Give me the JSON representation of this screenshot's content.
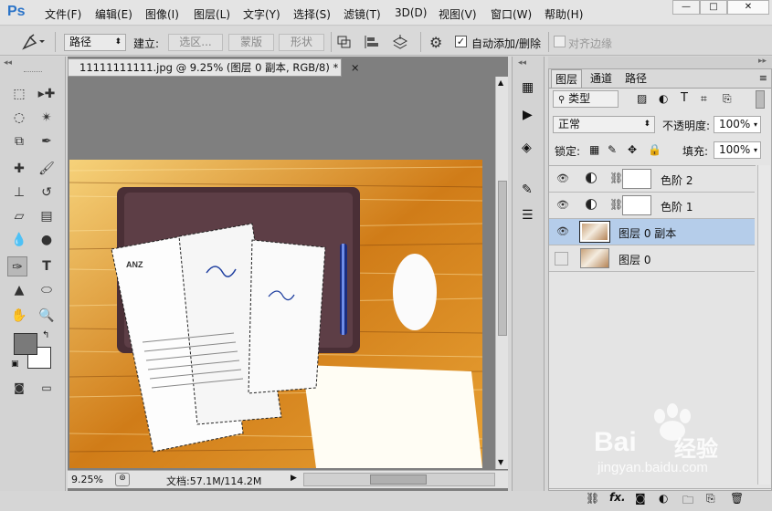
{
  "app": {
    "logo": "Ps"
  },
  "menu": [
    "文件(F)",
    "编辑(E)",
    "图像(I)",
    "图层(L)",
    "文字(Y)",
    "选择(S)",
    "滤镜(T)",
    "3D(D)",
    "视图(V)",
    "窗口(W)",
    "帮助(H)"
  ],
  "window_controls": {
    "minimize": "—",
    "maximize": "□",
    "close": "✕"
  },
  "options": {
    "mode_value": "路径",
    "build_label": "建立:",
    "selection_btn": "选区...",
    "mask_btn": "蒙版",
    "shape_btn": "形状",
    "auto_add_label": "自动添加/删除",
    "auto_add_checked": true,
    "align_edges_label": "对齐边缘",
    "align_edges_checked": false
  },
  "document": {
    "tab_title": "11111111111.jpg @ 9.25% (图层 0 副本, RGB/8) *",
    "close_icon": "×",
    "zoom": "9.25%",
    "doc_info": "文档:57.1M/114.2M",
    "doc_labels": {
      "anz": "ANZ"
    }
  },
  "layers_panel": {
    "tabs": [
      "图层",
      "通道",
      "路径"
    ],
    "filter_kind": "类型",
    "blend_mode": "正常",
    "opacity_label": "不透明度:",
    "opacity_value": "100%",
    "lock_label": "锁定:",
    "fill_label": "填充:",
    "fill_value": "100%",
    "layers": [
      {
        "name": "色阶 2",
        "type": "adjustment",
        "visible": true,
        "selected": false
      },
      {
        "name": "色阶 1",
        "type": "adjustment",
        "visible": true,
        "selected": false
      },
      {
        "name": "图层 0 副本",
        "type": "image",
        "visible": true,
        "selected": true
      },
      {
        "name": "图层 0",
        "type": "image",
        "visible": false,
        "selected": false
      }
    ],
    "bottom_icons": [
      "link-icon",
      "fx-icon",
      "add-mask-icon",
      "adjustment-icon",
      "folder-icon",
      "new-layer-icon",
      "trash-icon"
    ],
    "fx_label": "fx."
  },
  "watermark": {
    "brand": "Bai",
    "brand2": "经验",
    "url": "jingyan.baidu.com"
  }
}
